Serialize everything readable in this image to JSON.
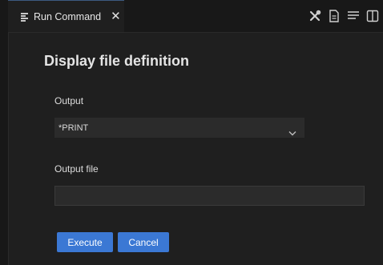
{
  "tab": {
    "label": "Run Command",
    "close_glyph": "✕",
    "icon": "file-lines-icon"
  },
  "toolbar": {
    "icons": [
      "tools-icon",
      "document-icon",
      "list-icon",
      "split-editor-icon"
    ]
  },
  "page": {
    "title": "Display file definition"
  },
  "output": {
    "label": "Output",
    "selected": "*PRINT"
  },
  "output_file": {
    "label": "Output file",
    "value": ""
  },
  "buttons": {
    "execute": "Execute",
    "cancel": "Cancel"
  },
  "colors": {
    "background": "#1f1f1f",
    "field_background": "#2b2b2b",
    "button": "#3b78d4",
    "text": "#e4e4e4"
  }
}
